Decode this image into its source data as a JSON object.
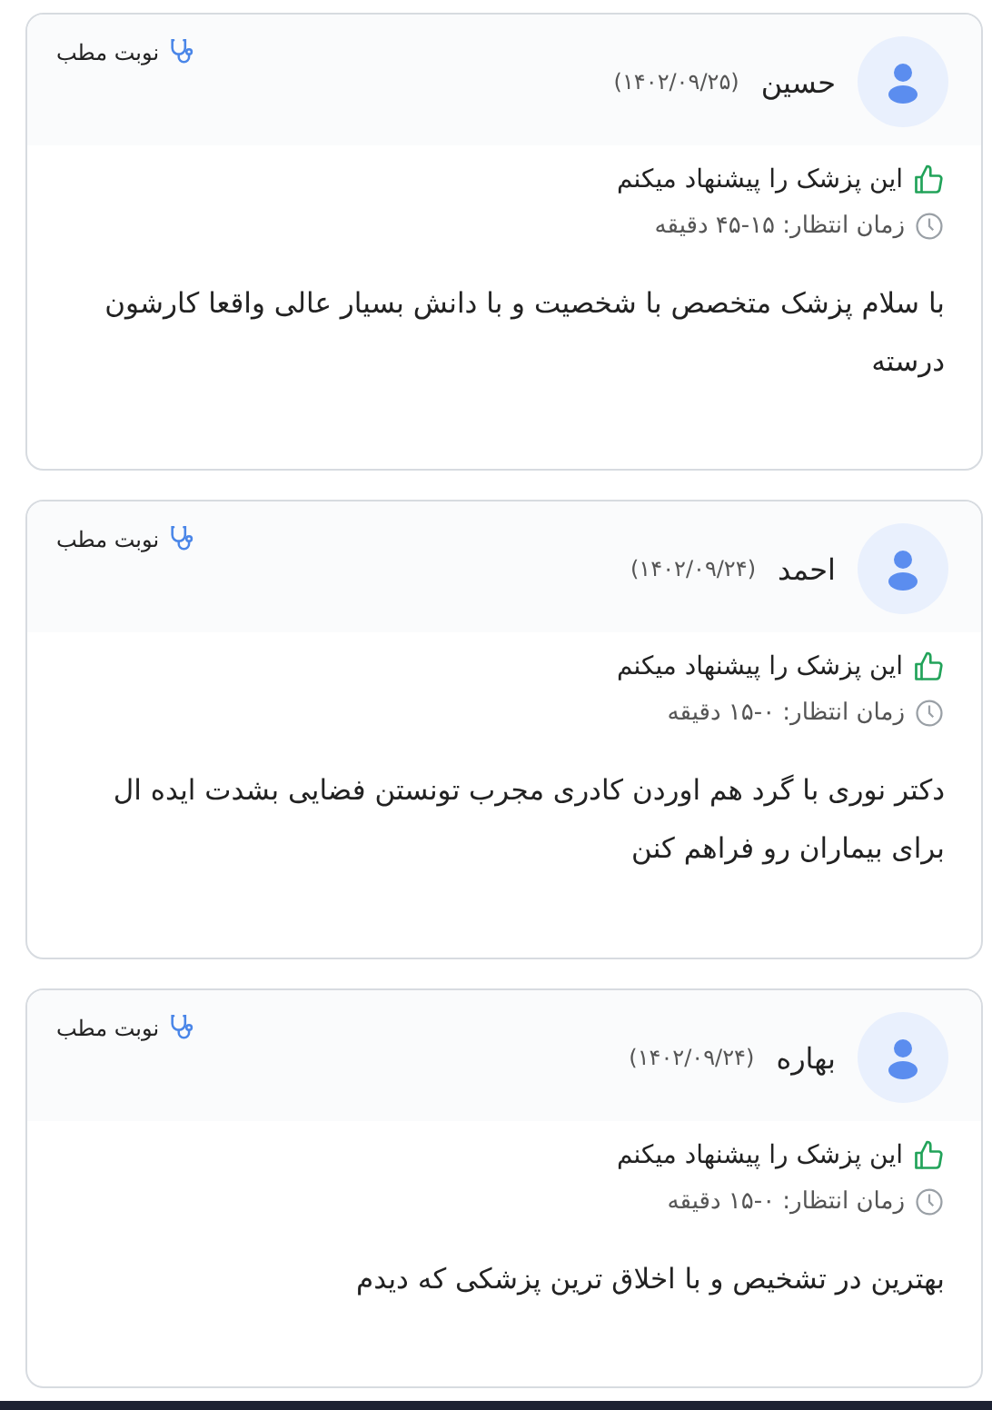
{
  "reviews": [
    {
      "appointment_type": "نوبت مطب",
      "name": "حسین",
      "date": "(۱۴۰۲/۰۹/۲۵)",
      "recommendation": "این پزشک را پیشنهاد میکنم",
      "wait_time": "زمان انتظار: ۱۵-۴۵ دقیقه",
      "comment": "با سلام پزشک متخصص با شخصیت و با دانش بسیار عالی واقعا کارشون درسته"
    },
    {
      "appointment_type": "نوبت مطب",
      "name": "احمد",
      "date": "(۱۴۰۲/۰۹/۲۴)",
      "recommendation": "این پزشک را پیشنهاد میکنم",
      "wait_time": "زمان انتظار: ۰-۱۵ دقیقه",
      "comment": "دکتر نوری با گرد هم اوردن کادری مجرب تونستن فضایی بشدت ایده ال برای بیماران رو فراهم کنن"
    },
    {
      "appointment_type": "نوبت مطب",
      "name": "بهاره",
      "date": "(۱۴۰۲/۰۹/۲۴)",
      "recommendation": "این پزشک را پیشنهاد میکنم",
      "wait_time": "زمان انتظار: ۰-۱۵ دقیقه",
      "comment": "بهترین در تشخیص و با اخلاق ترین پزشکی که دیدم"
    }
  ]
}
